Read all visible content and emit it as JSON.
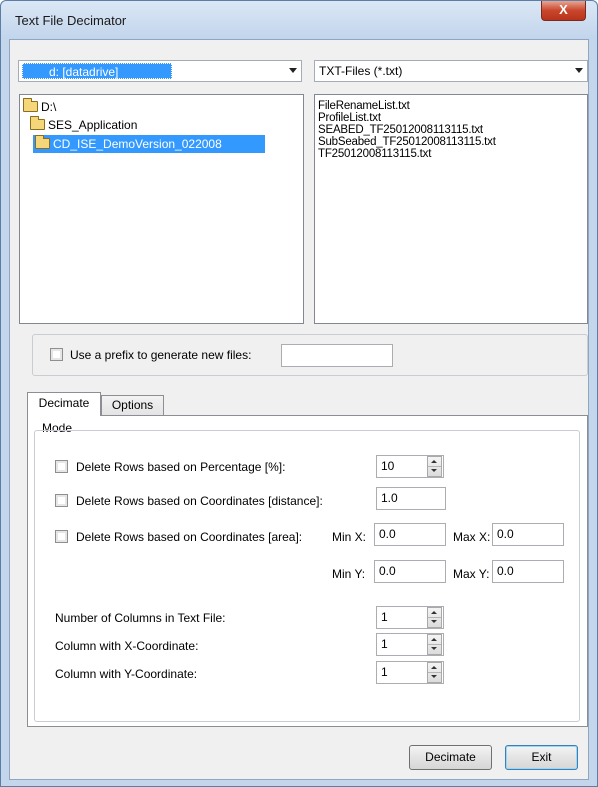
{
  "window": {
    "title": "Text File Decimator",
    "close_symbol": "X"
  },
  "drive_combo": {
    "value": "d: [datadrive]",
    "icon": "drive-icon"
  },
  "filter_combo": {
    "value": "TXT-Files (*.txt)"
  },
  "directories": [
    {
      "label": "D:\\",
      "icon": "open-folder-icon"
    },
    {
      "label": "SES_Application",
      "icon": "open-folder-icon"
    },
    {
      "label": "CD_ISE_DemoVersion_022008",
      "icon": "open-folder-icon",
      "selected": true
    }
  ],
  "files": [
    "FileRenameList.txt",
    "ProfileList.txt",
    "SEABED_TF25012008113115.txt",
    "SubSeabed_TF25012008113115.txt",
    "TF25012008113115.txt"
  ],
  "prefix": {
    "label": "Use a prefix to generate new files:",
    "value": ""
  },
  "tabs": [
    {
      "label": "Decimate",
      "active": true
    },
    {
      "label": "Options",
      "active": false
    }
  ],
  "mode": {
    "group_label": "Mode",
    "percentage": {
      "label": "Delete Rows based on Percentage [%]:",
      "value": "10"
    },
    "distance": {
      "label": "Delete Rows based on Coordinates [distance]:",
      "value": "1.0"
    },
    "area": {
      "label": "Delete Rows based on Coordinates [area]:",
      "min_x_label": "Min X:",
      "min_x": "0.0",
      "max_x_label": "Max X:",
      "max_x": "0.0",
      "min_y_label": "Min Y:",
      "min_y": "0.0",
      "max_y_label": "Max Y:",
      "max_y": "0.0"
    },
    "num_columns": {
      "label": "Number of Columns in Text File:",
      "value": "1"
    },
    "x_column": {
      "label": "Column with X-Coordinate:",
      "value": "1"
    },
    "y_column": {
      "label": "Column with Y-Coordinate:",
      "value": "1"
    }
  },
  "buttons": {
    "decimate": "Decimate",
    "exit": "Exit"
  },
  "colors": {
    "selection": "#3399ff",
    "frame": "#c4d6ec",
    "close": "#c9462c"
  }
}
